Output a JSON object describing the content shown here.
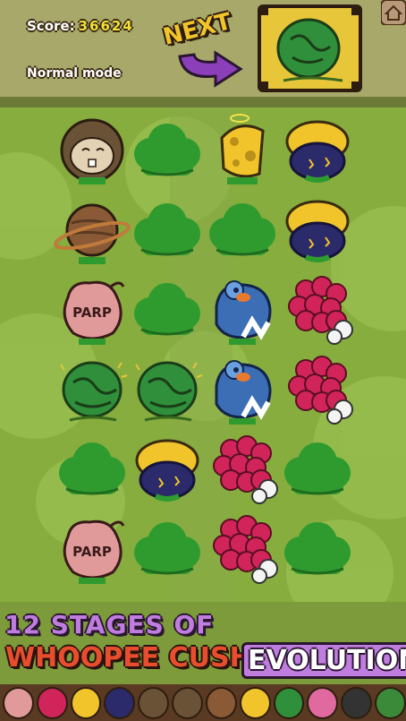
{
  "hud": {
    "score_label": "Score:",
    "score_value": "36624",
    "mode_label": "Normal mode",
    "next_label": "NEXT"
  },
  "board": {
    "columns": 4,
    "rows": 6,
    "cells": [
      [
        "hedgehog",
        "bush",
        "cheese",
        "bomb-cushion"
      ],
      [
        "planet",
        "bush",
        "bush",
        "bomb-cushion"
      ],
      [
        "parp-jug",
        "bush",
        "blue-bird",
        "raspberry"
      ],
      [
        "cabbage",
        "cabbage",
        "blue-bird",
        "raspberry"
      ],
      [
        "bush",
        "bomb-cushion",
        "raspberry",
        "bush"
      ],
      [
        "parp-jug",
        "bush",
        "raspberry",
        "bush"
      ]
    ],
    "parp_text": "PARP",
    "next_piece": "cabbage"
  },
  "banner": {
    "line1": "12 STAGES OF",
    "line2": "WHOOPEE CUSHION",
    "line3": "EVOLUTION"
  },
  "stages_strip": [
    "parp-jug",
    "raspberry",
    "cheese",
    "bomb-cushion",
    "hedgehog",
    "hedgehog",
    "planet",
    "cheese",
    "cabbage",
    "pink-blob",
    "cauldron",
    "green-monster"
  ],
  "colors": {
    "bush": "#2f9b2e",
    "grass": "#7ea53a",
    "raspberry": "#d0245a",
    "cushion_yellow": "#f2c42b",
    "bird_blue": "#3b6eb4",
    "parp_pink": "#e09a9a",
    "cabbage": "#2f8f3a",
    "banner_purple": "#c07de0",
    "banner_red": "#e84e2e"
  }
}
